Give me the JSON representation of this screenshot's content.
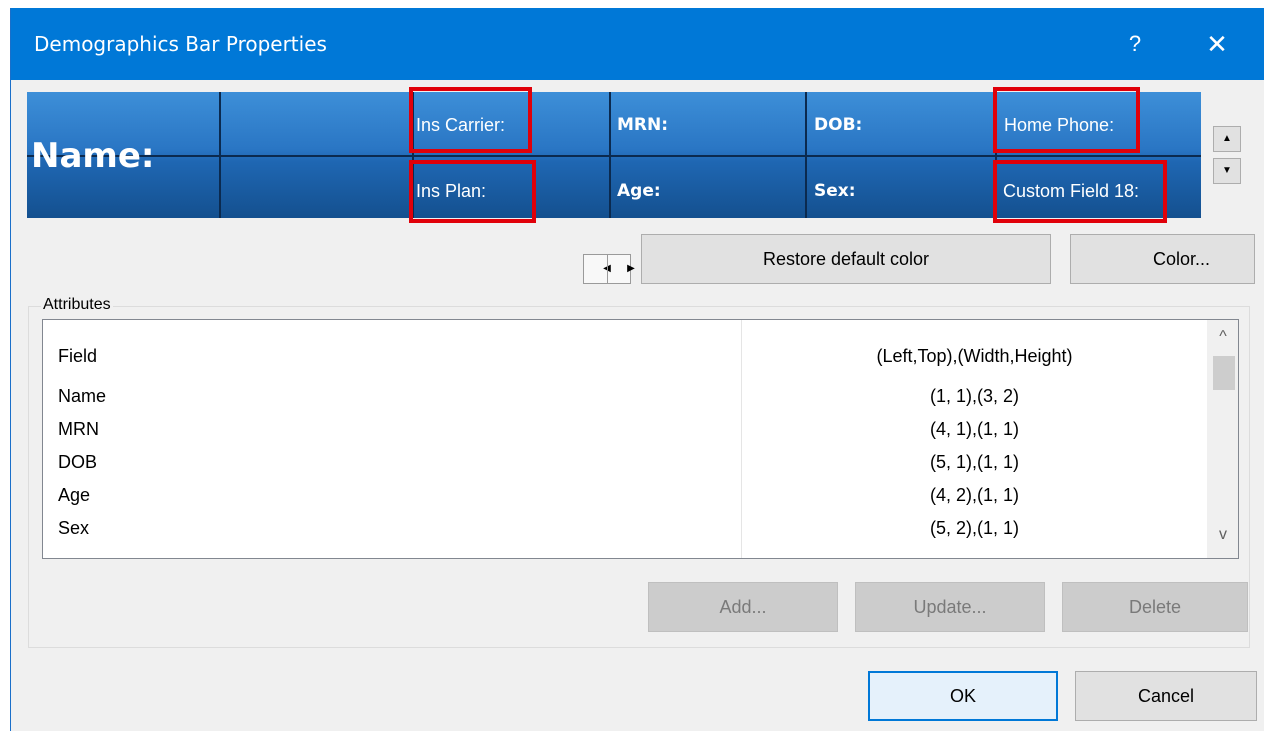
{
  "window": {
    "title": "Demographics Bar Properties",
    "help_glyph": "?",
    "close_glyph": "✕"
  },
  "demo_bar": {
    "name_label": "Name:",
    "cells": {
      "ins_carrier": "Ins Carrier:",
      "ins_plan": "Ins Plan:",
      "mrn": "MRN:",
      "age": "Age:",
      "dob": "DOB:",
      "sex": "Sex:",
      "home_phone": "Home Phone:",
      "custom_field": "Custom Field 18:"
    },
    "highlight_color": "#e0000a",
    "bar_color": "#2a76c4"
  },
  "controls": {
    "move_up_glyph": "▲",
    "move_down_glyph": "▼",
    "move_left_glyph": "◀",
    "move_right_glyph": "▶",
    "restore_default_color": "Restore default color",
    "color": "Color..."
  },
  "attributes": {
    "group_label": "Attributes",
    "columns": [
      "Field",
      "(Left,Top),(Width,Height)"
    ],
    "rows": [
      {
        "field": "Name",
        "pos": "(1, 1),(3, 2)"
      },
      {
        "field": "MRN",
        "pos": "(4, 1),(1, 1)"
      },
      {
        "field": "DOB",
        "pos": "(5, 1),(1, 1)"
      },
      {
        "field": "Age",
        "pos": "(4, 2),(1, 1)"
      },
      {
        "field": "Sex",
        "pos": "(5, 2),(1, 1)"
      }
    ],
    "scroll_up_glyph": "^",
    "scroll_down_glyph": "v",
    "add": "Add...",
    "update": "Update...",
    "delete": "Delete"
  },
  "footer": {
    "ok": "OK",
    "cancel": "Cancel"
  }
}
